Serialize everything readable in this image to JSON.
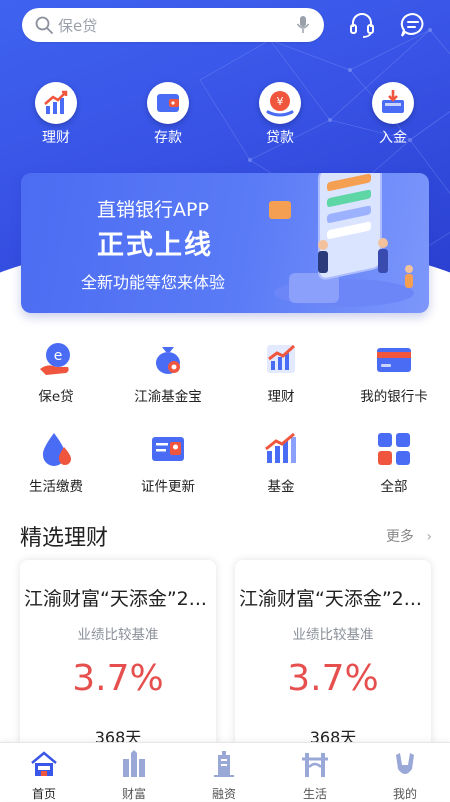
{
  "search": {
    "placeholder": "保e贷",
    "icon": "search-icon",
    "voice_icon": "microphone-icon"
  },
  "header_icons": [
    "headset-icon",
    "message-icon"
  ],
  "quick_actions": [
    {
      "label": "理财",
      "icon": "chart-growth-icon"
    },
    {
      "label": "存款",
      "icon": "wallet-icon"
    },
    {
      "label": "贷款",
      "icon": "yuan-coin-icon"
    },
    {
      "label": "入金",
      "icon": "deposit-icon"
    }
  ],
  "banner": {
    "line1": "直销银行APP",
    "line2": "正式上线",
    "line3": "全新功能等您来体验"
  },
  "services": [
    {
      "label": "保e贷",
      "icon": "e-loan-icon"
    },
    {
      "label": "江渝基金宝",
      "icon": "money-bag-icon"
    },
    {
      "label": "理财",
      "icon": "chart-growth-icon"
    },
    {
      "label": "我的银行卡",
      "icon": "bank-card-icon"
    },
    {
      "label": "生活缴费",
      "icon": "water-drop-icon"
    },
    {
      "label": "证件更新",
      "icon": "id-card-icon"
    },
    {
      "label": "基金",
      "icon": "fund-chart-icon"
    },
    {
      "label": "全部",
      "icon": "grid-icon"
    }
  ],
  "featured": {
    "title": "精选理财",
    "more": "更多",
    "products": [
      {
        "name": "江渝财富“天添金”2...",
        "benchmark_label": "业绩比较基准",
        "rate": "3.7%",
        "term": "368天"
      },
      {
        "name": "江渝财富“天添金”2...",
        "benchmark_label": "业绩比较基准",
        "rate": "3.7%",
        "term": "368天"
      }
    ]
  },
  "tabs": [
    {
      "label": "首页",
      "icon": "home-icon",
      "active": true
    },
    {
      "label": "财富",
      "icon": "wealth-icon",
      "active": false
    },
    {
      "label": "融资",
      "icon": "financing-icon",
      "active": false
    },
    {
      "label": "生活",
      "icon": "life-icon",
      "active": false
    },
    {
      "label": "我的",
      "icon": "profile-icon",
      "active": false
    }
  ],
  "colors": {
    "primary": "#3a56e8",
    "rate_red": "#e5504e",
    "card_red": "#f0563e"
  }
}
